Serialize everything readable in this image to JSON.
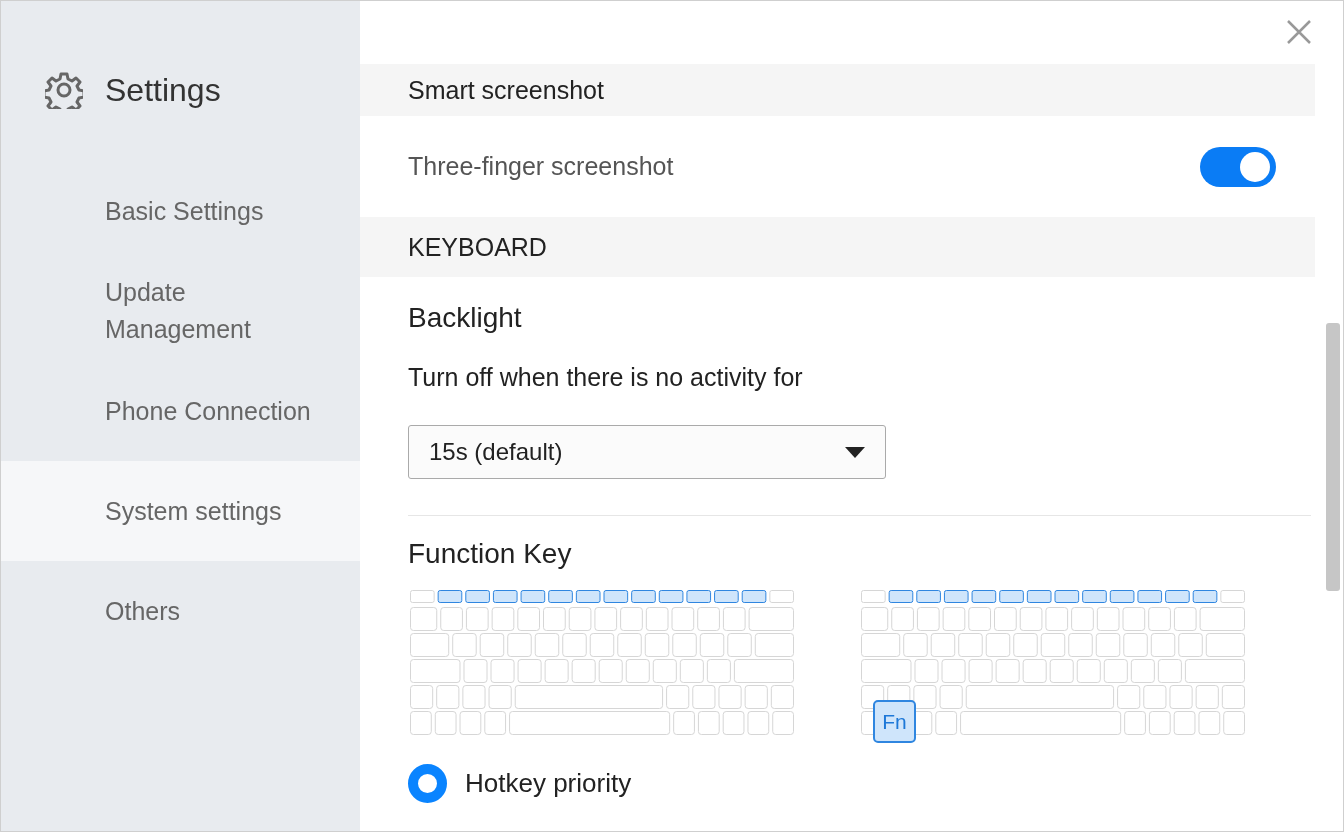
{
  "window": {
    "title": "Settings"
  },
  "sidebar": {
    "items": [
      {
        "label": "Basic Settings",
        "selected": false
      },
      {
        "label": "Update Management",
        "selected": false
      },
      {
        "label": "Phone Connection",
        "selected": false
      },
      {
        "label": "System settings",
        "selected": true
      },
      {
        "label": "Others",
        "selected": false
      }
    ]
  },
  "sections": [
    {
      "kind": "header",
      "title": "Smart screenshot"
    },
    {
      "kind": "toggle",
      "label": "Three-finger screenshot",
      "on": true
    },
    {
      "kind": "header",
      "title": "KEYBOARD"
    },
    {
      "kind": "subheading",
      "title": "Backlight"
    },
    {
      "kind": "text",
      "text": "Turn off when there is no activity for"
    },
    {
      "kind": "dropdown",
      "value": "15s (default)"
    },
    {
      "kind": "divider"
    },
    {
      "kind": "subheading",
      "title": "Function Key"
    },
    {
      "kind": "keyboards",
      "keyboards": [
        {
          "kind": "function-row"
        },
        {
          "kind": "fn-combo",
          "fn_label": "Fn"
        }
      ]
    },
    {
      "kind": "radio",
      "label": "Hotkey priority",
      "selected": true
    }
  ]
}
